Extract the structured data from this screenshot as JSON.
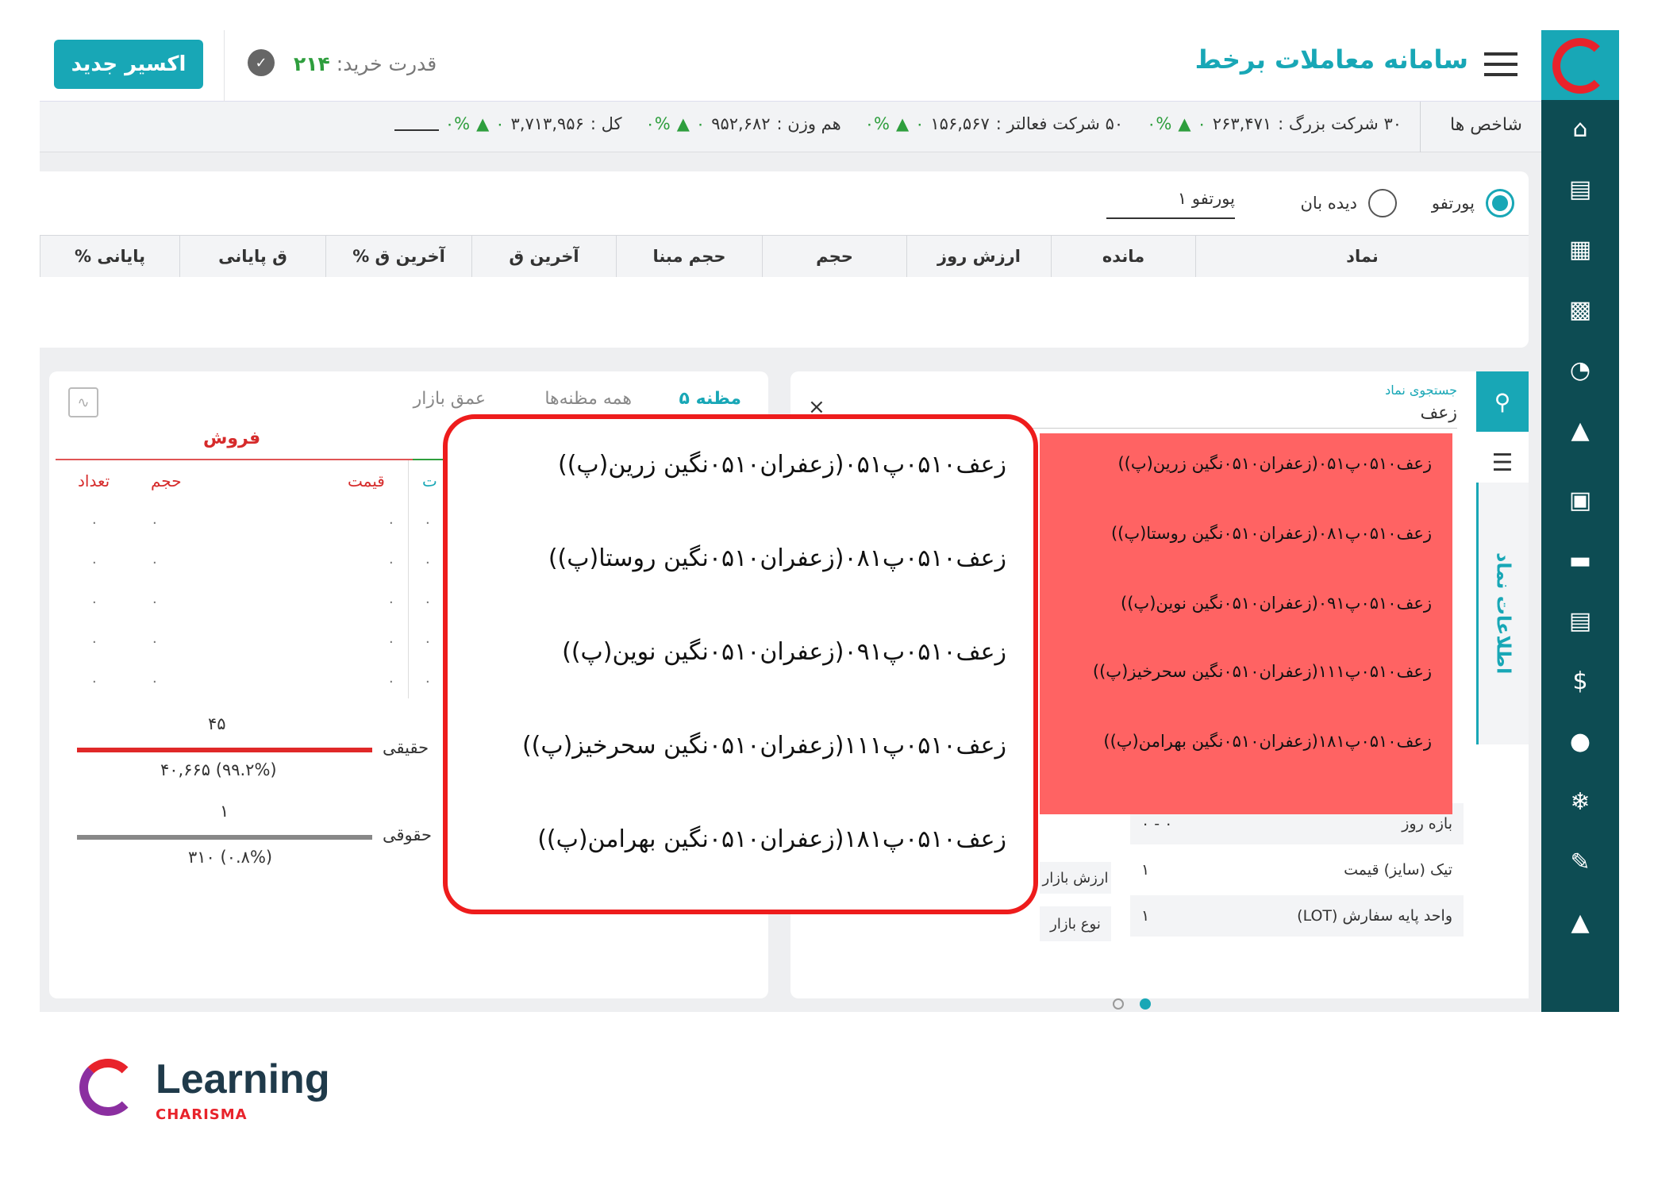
{
  "app_title": "سامانه معاملات برخط",
  "new_button": "اکسیر جدید",
  "buying_power": {
    "label": "قدرت خرید:",
    "value": "۲۱۴"
  },
  "indices": {
    "label": "شاخص ها",
    "items": [
      {
        "name": "کل :",
        "value": "۳,۷۱۳,۹۵۶",
        "change": "۰%",
        "delta": "۰"
      },
      {
        "name": "هم وزن :",
        "value": "۹۵۲,۶۸۲",
        "change": "۰%",
        "delta": "۰"
      },
      {
        "name": "۵۰ شرکت فعالتر :",
        "value": "۱۵۶,۵۶۷",
        "change": "۰%",
        "delta": "۰"
      },
      {
        "name": "۳۰ شرکت بزرگ :",
        "value": "۲۶۳,۴۷۱",
        "change": "۰%",
        "delta": "۰"
      }
    ]
  },
  "watch": {
    "radio_portfolio": "پورتفو",
    "radio_watch": "دیده بان",
    "selected_list": "پورتفو ۱"
  },
  "table_headers": [
    "نماد",
    "مانده",
    "ارزش روز",
    "حجم",
    "حجم مبنا",
    "آخرین ق",
    "% آخرین ق",
    "ق پایانی",
    "% پایانی"
  ],
  "search": {
    "label": "جستجوی نماد",
    "value": "زعف",
    "side_tab": "اطلاعات نماد"
  },
  "dropdown_items": [
    "زعف۰۵۱۰پ۰۵۱(زعفران۰۵۱۰نگین زرین(پ))",
    "زعف۰۵۱۰پ۰۸۱(زعفران۰۵۱۰نگین روستا(پ))",
    "زعف۰۵۱۰پ۰۹۱(زعفران۰۵۱۰نگین نوین(پ))",
    "زعف۰۵۱۰پ۱۱۱(زعفران۰۵۱۰نگین سحرخیز(پ))",
    "زعف۰۵۱۰پ۱۸۱(زعفران۰۵۱۰نگین بهرامن(پ))"
  ],
  "info_rows": [
    {
      "label": "بازه روز",
      "value": "۰ - ۰"
    },
    {
      "label": "تیک (سایز) قیمت",
      "value": "۱"
    },
    {
      "label": "واحد پایه سفارش (LOT)",
      "value": "۱"
    }
  ],
  "info_left_labels": [
    "ارزش بازار",
    "نوع بازار"
  ],
  "depth": {
    "tabs": [
      "۵ مظنه",
      "همه مظنه‌ها",
      "عمق بازار"
    ],
    "sell_title": "فروش",
    "columns": [
      "قیمت",
      "حجم",
      "تعداد"
    ],
    "buy_col_partial": "ت",
    "zero": "۰",
    "real": {
      "label": "حقیقی",
      "top": "۴۵",
      "bottom": "۴۰,۶۶۵ (۹۹.۲%)"
    },
    "legal": {
      "label": "حقوقی",
      "top": "۱",
      "bottom": "۳۱۰ (۰.۸%)"
    }
  },
  "brand": {
    "name": "Learning",
    "sub": "CHARISMA"
  },
  "colors": {
    "teal": "#18a7b6",
    "sidebar": "#0d4c53",
    "highlight": "#ff6363",
    "outline": "#ee1c1c",
    "sell": "#d62b2b",
    "green": "#2e9e3d"
  }
}
